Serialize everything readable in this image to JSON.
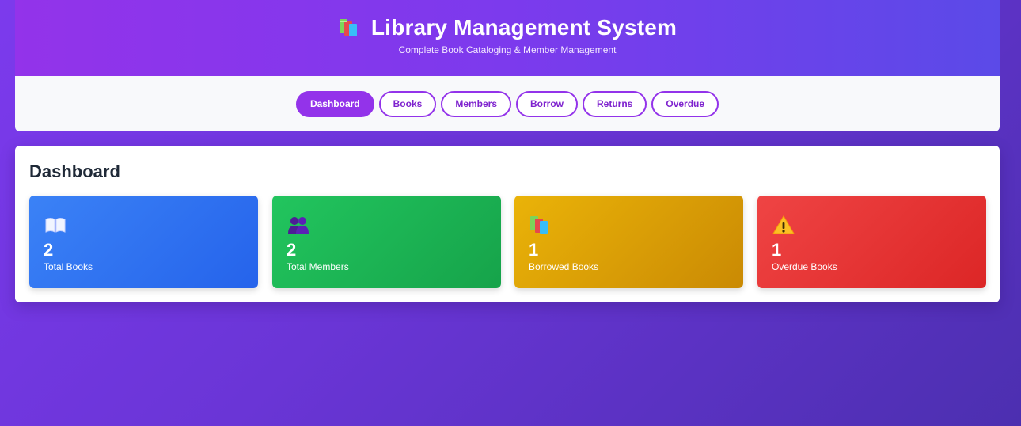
{
  "header": {
    "title": "Library Management System",
    "subtitle": "Complete Book Cataloging & Member Management",
    "icon": "books-icon"
  },
  "nav": {
    "items": [
      {
        "label": "Dashboard",
        "active": true
      },
      {
        "label": "Books",
        "active": false
      },
      {
        "label": "Members",
        "active": false
      },
      {
        "label": "Borrow",
        "active": false
      },
      {
        "label": "Returns",
        "active": false
      },
      {
        "label": "Overdue",
        "active": false
      }
    ],
    "accent_color": "#9333ea"
  },
  "dashboard": {
    "title": "Dashboard",
    "stats": [
      {
        "icon": "open-book-icon",
        "value": "2",
        "label": "Total Books",
        "color": "#3b82f6"
      },
      {
        "icon": "members-icon",
        "value": "2",
        "label": "Total Members",
        "color": "#22c55e"
      },
      {
        "icon": "books-icon",
        "value": "1",
        "label": "Borrowed Books",
        "color": "#eab308"
      },
      {
        "icon": "warning-icon",
        "value": "1",
        "label": "Overdue Books",
        "color": "#ef4444"
      }
    ]
  }
}
